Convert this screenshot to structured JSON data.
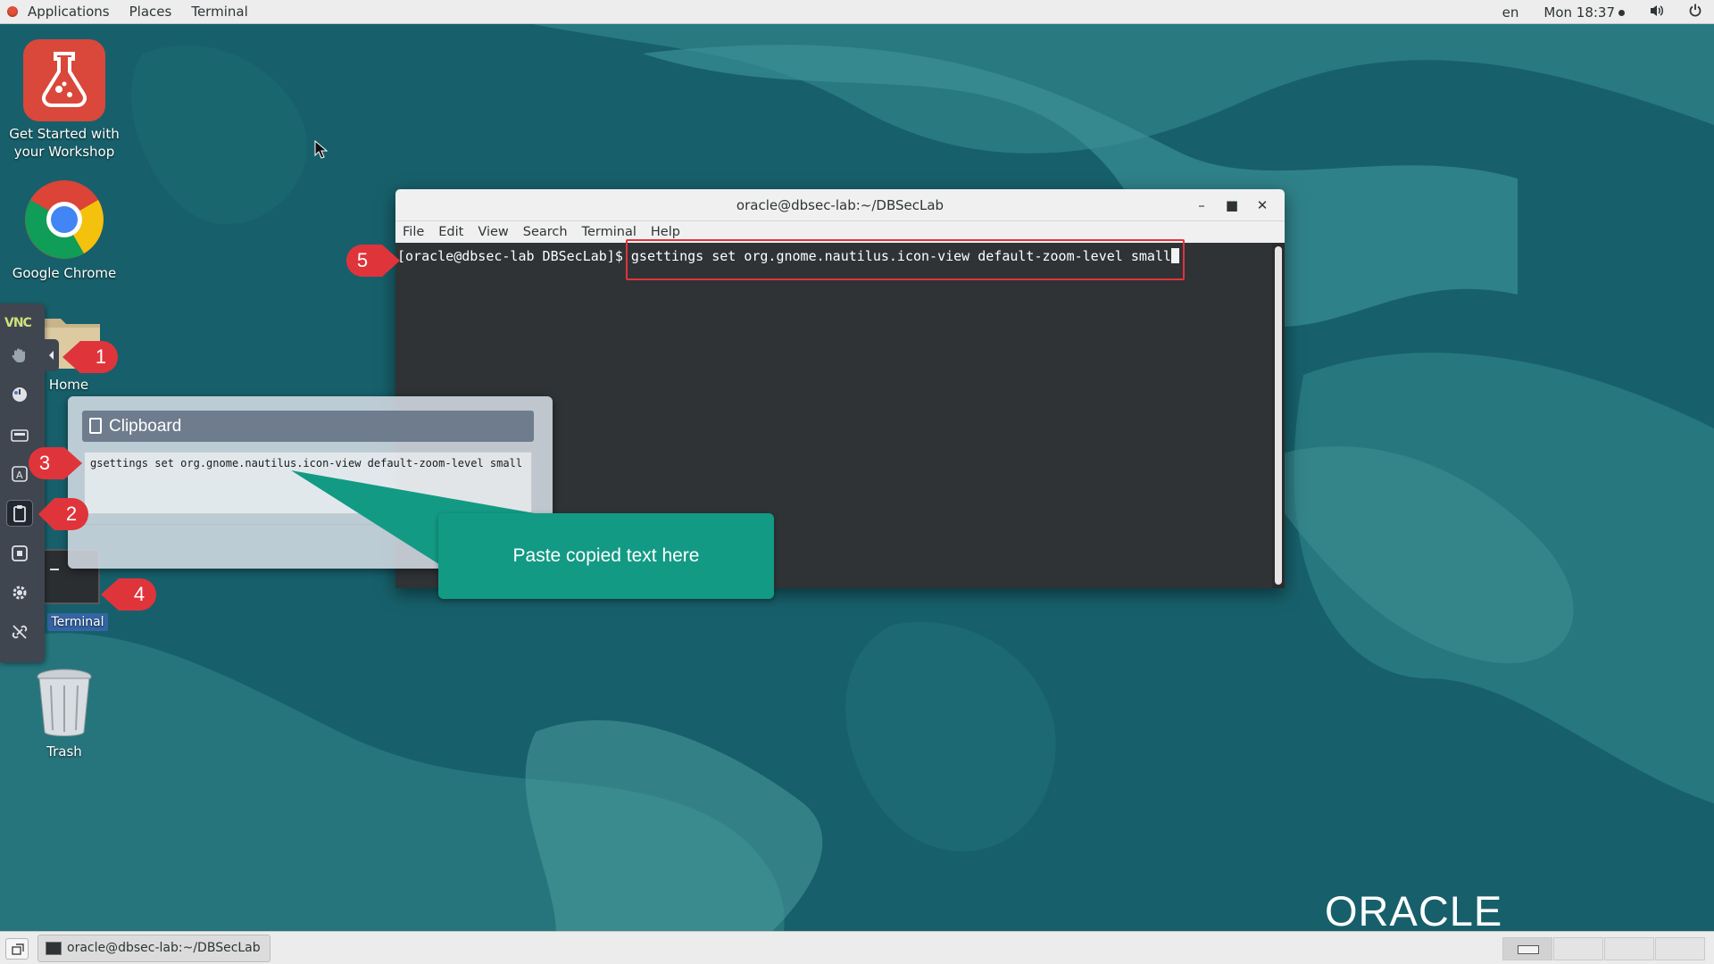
{
  "topbar": {
    "menus": [
      "Applications",
      "Places",
      "Terminal"
    ],
    "language": "en",
    "clock": "Mon 18:37"
  },
  "desktop_icons": {
    "workshop": "Get Started with your Workshop",
    "chrome": "Google Chrome",
    "home": "Home",
    "terminal": "Terminal",
    "trash": "Trash"
  },
  "terminal": {
    "title": "oracle@dbsec-lab:~/DBSecLab",
    "menu": [
      "File",
      "Edit",
      "View",
      "Search",
      "Terminal",
      "Help"
    ],
    "prompt": "[oracle@dbsec-lab DBSecLab]$ ",
    "command": "gsettings set org.gnome.nautilus.icon-view default-zoom-level small"
  },
  "vnc": {
    "logo": "VNC"
  },
  "clipboard": {
    "title": "Clipboard",
    "text": "gsettings set org.gnome.nautilus.icon-view default-zoom-level small"
  },
  "callout": {
    "text": "Paste copied text here"
  },
  "markers": [
    "1",
    "2",
    "3",
    "4",
    "5"
  ],
  "branding": {
    "oracle": "ORACLE"
  },
  "taskbar": {
    "task_label": "oracle@dbsec-lab:~/DBSecLab"
  },
  "colors": {
    "desktop_bg": "#17606b",
    "marker_red": "#e0343b",
    "callout_green": "#139a85",
    "terminal_bg": "#2f3336"
  }
}
